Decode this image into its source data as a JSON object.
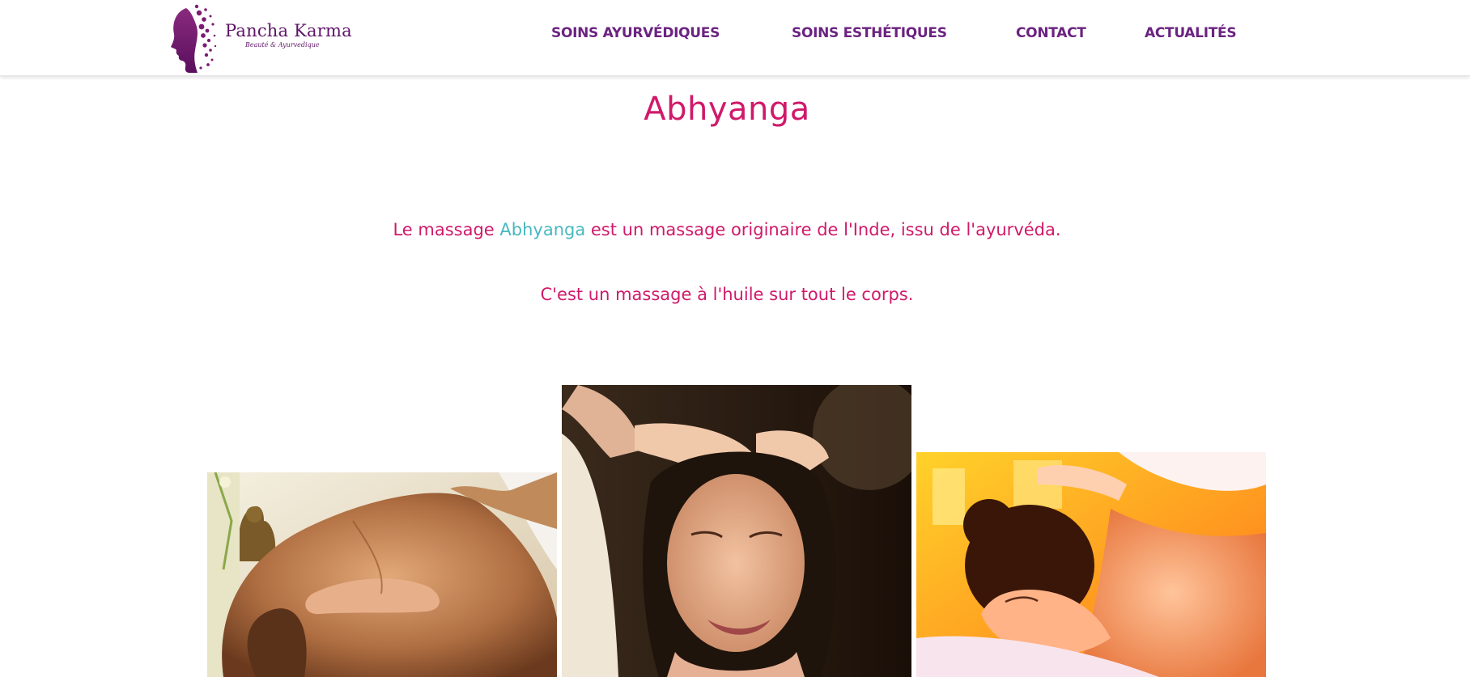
{
  "site": {
    "logo": {
      "name": "Pancha Karma",
      "tagline": "Beauté & Ayurvedique"
    }
  },
  "nav": {
    "items": [
      {
        "label": "SOINS AYURVÉDIQUES"
      },
      {
        "label": "SOINS ESTHÉTIQUES"
      },
      {
        "label": "CONTACT"
      },
      {
        "label": "ACTUALITÉS"
      }
    ]
  },
  "main": {
    "title": "Abhyanga",
    "intro": {
      "before": "Le massage ",
      "accent": "Abhyanga",
      "after": " est un massage originaire de l'Inde, issu de l'ayurvéda."
    },
    "second": "C'est un massage à l'huile sur tout le corps."
  },
  "colors": {
    "nav": "#6b2381",
    "title": "#d0196a",
    "accent": "#49b8c0",
    "logo": "#5e1468"
  }
}
